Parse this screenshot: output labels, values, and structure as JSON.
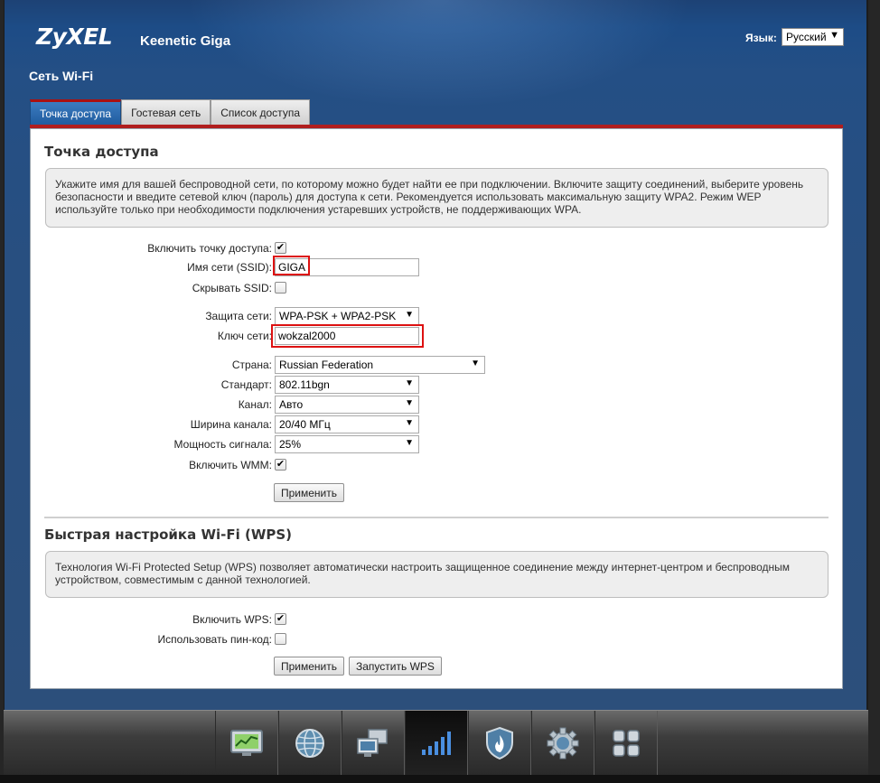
{
  "header": {
    "brand": "ZyXEL",
    "model": "Keenetic Giga",
    "language_label": "Язык:",
    "language_value": "Русский"
  },
  "page_title": "Сеть Wi-Fi",
  "tabs": [
    {
      "label": "Точка доступа",
      "active": true
    },
    {
      "label": "Гостевая сеть",
      "active": false
    },
    {
      "label": "Список доступа",
      "active": false
    }
  ],
  "access_point": {
    "title": "Точка доступа",
    "info": "Укажите имя для вашей беспроводной сети, по которому можно будет найти ее при подключении. Включите защиту соединений, выберите уровень безопасности и введите сетевой ключ (пароль) для доступа к сети. Рекомендуется использовать максимальную защиту WPA2. Режим WEP используйте только при необходимости подключения устаревших устройств, не поддерживающих WPA.",
    "fields": {
      "enable_label": "Включить точку доступа:",
      "enable_checked": true,
      "ssid_label": "Имя сети (SSID):",
      "ssid_value": "GIGA",
      "hide_ssid_label": "Скрывать SSID:",
      "hide_ssid_checked": false,
      "security_label": "Защита сети:",
      "security_value": "WPA-PSK + WPA2-PSK",
      "key_label": "Ключ сети:",
      "key_value": "wokzal2000",
      "country_label": "Страна:",
      "country_value": "Russian Federation",
      "standard_label": "Стандарт:",
      "standard_value": "802.11bgn",
      "channel_label": "Канал:",
      "channel_value": "Авто",
      "width_label": "Ширина канала:",
      "width_value": "20/40 МГц",
      "power_label": "Мощность сигнала:",
      "power_value": "25%",
      "wmm_label": "Включить WMM:",
      "wmm_checked": true
    },
    "apply_label": "Применить"
  },
  "wps": {
    "title": "Быстрая настройка Wi-Fi (WPS)",
    "info": "Технология Wi-Fi Protected Setup (WPS) позволяет автоматически настроить защищенное соединение между интернет-центром и беспроводным устройством, совместимым с данной технологией.",
    "enable_label": "Включить WPS:",
    "enable_checked": true,
    "pin_label": "Использовать пин-код:",
    "pin_checked": false,
    "apply_label": "Применить",
    "start_label": "Запустить WPS"
  },
  "dock": [
    {
      "icon": "monitor-chart-icon",
      "active": false
    },
    {
      "icon": "globe-icon",
      "active": false
    },
    {
      "icon": "network-computers-icon",
      "active": false
    },
    {
      "icon": "wifi-signal-bars-icon",
      "active": true
    },
    {
      "icon": "shield-flame-icon",
      "active": false
    },
    {
      "icon": "gear-icon",
      "active": false
    },
    {
      "icon": "apps-grid-icon",
      "active": false
    }
  ]
}
